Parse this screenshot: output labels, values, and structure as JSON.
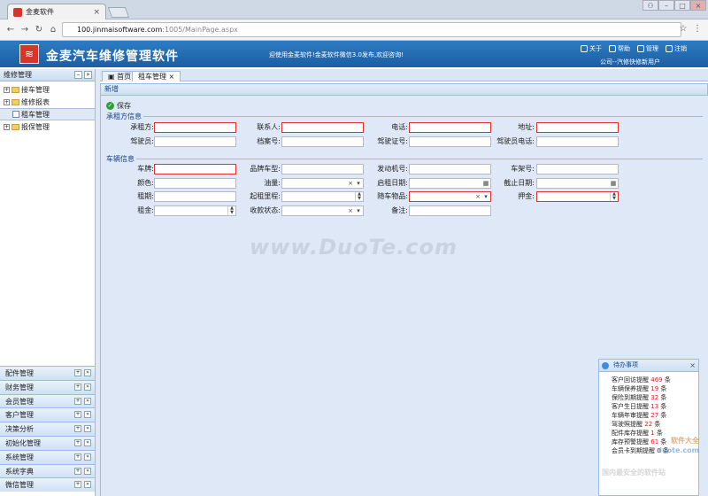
{
  "browser": {
    "tab_title": "金麦软件",
    "url_host": "100.jinmaisoftware.com",
    "url_path": ":1005/MainPage.aspx"
  },
  "header": {
    "app_title": "金麦汽车维修管理软件",
    "welcome": "迎使用金麦软件!金麦软件微信3.0发布,欢迎咨询!",
    "links": [
      "关于",
      "帮助",
      "管理",
      "注销"
    ],
    "company": "公司--汽修快修新用户"
  },
  "left": {
    "title": "维修管理",
    "tree": [
      {
        "label": "接车管理",
        "type": "folder"
      },
      {
        "label": "维修报表",
        "type": "folder"
      },
      {
        "label": "租车管理",
        "type": "page",
        "selected": true
      },
      {
        "label": "报保管理",
        "type": "folder"
      }
    ],
    "accordion": [
      "配件管理",
      "财务管理",
      "会员管理",
      "客户管理",
      "决策分析",
      "初始化管理",
      "系统管理",
      "系统字典",
      "微信管理"
    ]
  },
  "tabs": [
    "首页",
    "租车管理"
  ],
  "panel": {
    "title": "新增",
    "save": "保存",
    "section1": "承租方信息",
    "section2": "车辆信息",
    "fields1": [
      [
        "承租方:",
        "联系人:",
        "电话:",
        "地址:"
      ],
      [
        "驾驶员:",
        "档案号:",
        "驾驶证号:",
        "驾驶员电话:"
      ]
    ],
    "fields2": [
      [
        "车牌:",
        "品牌车型:",
        "发动机号:",
        "车架号:"
      ],
      [
        "颜色:",
        "油量:",
        "启租日期:",
        "截止日期:"
      ],
      [
        "租期:",
        "起租里程:",
        "随车物品:",
        "押金:"
      ],
      [
        "租金:",
        "收款状态:",
        "备注:"
      ]
    ]
  },
  "watermark": "www.DuoTe.com",
  "popup": {
    "title": "待办事项",
    "items": [
      {
        "label": "客户回访提醒",
        "count": "469",
        "unit": "条"
      },
      {
        "label": "车辆保养提醒",
        "count": "19",
        "unit": "条"
      },
      {
        "label": "保险到期提醒",
        "count": "32",
        "unit": "条"
      },
      {
        "label": "客户生日提醒",
        "count": "13",
        "unit": "条"
      },
      {
        "label": "车辆年审提醒",
        "count": "27",
        "unit": "条"
      },
      {
        "label": "驾驶照提醒",
        "count": "22",
        "unit": "条"
      },
      {
        "label": "配件库存提醒",
        "count": "1",
        "unit": "条"
      },
      {
        "label": "库存预警提醒",
        "count": "61",
        "unit": "条"
      },
      {
        "label": "会员卡到期提醒",
        "count": "0",
        "unit": "条"
      }
    ]
  },
  "overlay": {
    "b1": "软件大全",
    "b2": "duote.com",
    "b3": "国内最安全的软件站"
  }
}
